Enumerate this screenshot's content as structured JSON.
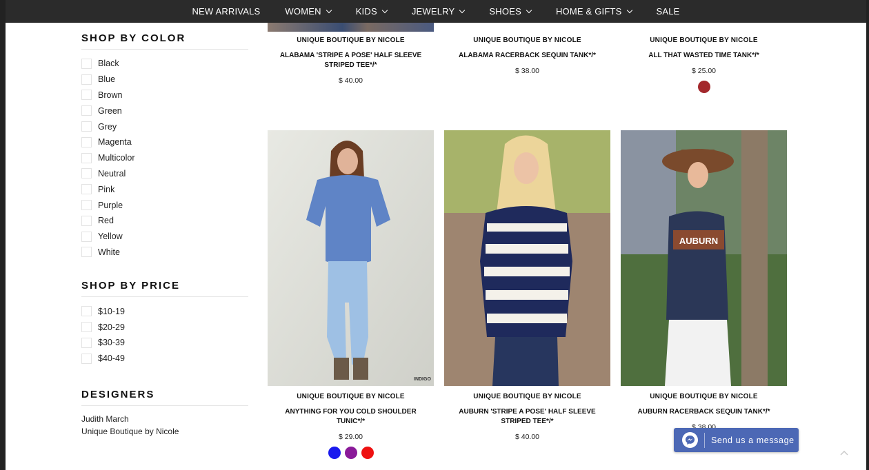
{
  "nav": {
    "items": [
      {
        "label": "NEW ARRIVALS",
        "dropdown": false
      },
      {
        "label": "WOMEN",
        "dropdown": true
      },
      {
        "label": "KIDS",
        "dropdown": true
      },
      {
        "label": "JEWELRY",
        "dropdown": true
      },
      {
        "label": "SHOES",
        "dropdown": true
      },
      {
        "label": "HOME & GIFTS",
        "dropdown": true
      },
      {
        "label": "SALE",
        "dropdown": false
      }
    ]
  },
  "sidebar": {
    "color": {
      "title": "SHOP BY COLOR",
      "options": [
        "Black",
        "Blue",
        "Brown",
        "Green",
        "Grey",
        "Magenta",
        "Multicolor",
        "Neutral",
        "Pink",
        "Purple",
        "Red",
        "Yellow",
        "White"
      ]
    },
    "price": {
      "title": "SHOP BY PRICE",
      "options": [
        "$10-19",
        "$20-29",
        "$30-39",
        "$40-49"
      ]
    },
    "designers": {
      "title": "DESIGNERS",
      "items": [
        "Judith March",
        "Unique Boutique by Nicole"
      ]
    }
  },
  "products": [
    {
      "brand": "UNIQUE BOUTIQUE BY NICOLE",
      "name": "ALABAMA 'STRIPE A POSE' HALF SLEEVE STRIPED TEE*/*",
      "price": "$ 40.00",
      "swatches": []
    },
    {
      "brand": "UNIQUE BOUTIQUE BY NICOLE",
      "name": "ALABAMA RACERBACK SEQUIN TANK*/*",
      "price": "$ 38.00",
      "swatches": []
    },
    {
      "brand": "UNIQUE BOUTIQUE BY NICOLE",
      "name": "ALL THAT WASTED TIME TANK*/*",
      "price": "$ 25.00",
      "swatches": [
        "#a3282c"
      ]
    },
    {
      "brand": "UNIQUE BOUTIQUE BY NICOLE",
      "name": "ANYTHING FOR YOU COLD SHOULDER TUNIC*/*",
      "price": "$ 29.00",
      "swatches": [
        "#1a1aee",
        "#8a1a99",
        "#ee1111"
      ],
      "image_tag": "INDIGO"
    },
    {
      "brand": "UNIQUE BOUTIQUE BY NICOLE",
      "name": "AUBURN 'STRIPE A POSE' HALF SLEEVE STRIPED TEE*/*",
      "price": "$ 40.00",
      "swatches": []
    },
    {
      "brand": "UNIQUE BOUTIQUE BY NICOLE",
      "name": "AUBURN RACERBACK SEQUIN TANK*/*",
      "price": "$ 38.00",
      "swatches": [],
      "shirt_text": "AUBURN"
    }
  ],
  "chat": {
    "label": "Send us a message"
  },
  "colors": {
    "nav_bg": "#2b2b2b",
    "chat_bg": "#4c68b5"
  }
}
